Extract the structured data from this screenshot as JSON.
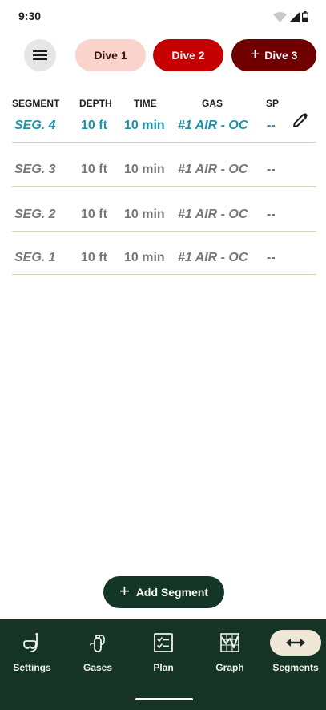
{
  "status_bar": {
    "time": "9:30"
  },
  "header": {
    "menu_icon": "hamburger-icon",
    "dives": [
      {
        "label": "Dive 1",
        "color": "#fbd3cd"
      },
      {
        "label": "Dive 2",
        "color": "#c40000"
      },
      {
        "label": "Dive 3",
        "color": "#700000",
        "icon": "plus-icon"
      }
    ]
  },
  "table": {
    "headers": {
      "segment": "SEGMENT",
      "depth": "DEPTH",
      "time": "TIME",
      "gas": "GAS",
      "sp": "SP"
    },
    "rows": [
      {
        "segment": "SEG. 4",
        "depth": "10 ft",
        "time": "10 min",
        "gas": "#1 AIR - OC",
        "sp": "--",
        "active": true
      },
      {
        "segment": "SEG. 3",
        "depth": "10 ft",
        "time": "10 min",
        "gas": "#1 AIR - OC",
        "sp": "--",
        "active": false
      },
      {
        "segment": "SEG. 2",
        "depth": "10 ft",
        "time": "10 min",
        "gas": "#1 AIR - OC",
        "sp": "--",
        "active": false
      },
      {
        "segment": "SEG. 1",
        "depth": "10 ft",
        "time": "10 min",
        "gas": "#1 AIR - OC",
        "sp": "--",
        "active": false
      }
    ],
    "edit_icon": "pencil-icon",
    "active_color": "#1a93a8"
  },
  "add_segment": {
    "label": "Add Segment",
    "icon": "plus-icon"
  },
  "bottom_nav": {
    "items": [
      {
        "label": "Settings",
        "icon": "snorkel-mask-icon"
      },
      {
        "label": "Gases",
        "icon": "gas-tank-icon"
      },
      {
        "label": "Plan",
        "icon": "checklist-icon"
      },
      {
        "label": "Graph",
        "icon": "graph-icon"
      },
      {
        "label": "Segments",
        "icon": "horizontal-arrows-icon",
        "active": true
      }
    ],
    "background": "#153426"
  }
}
